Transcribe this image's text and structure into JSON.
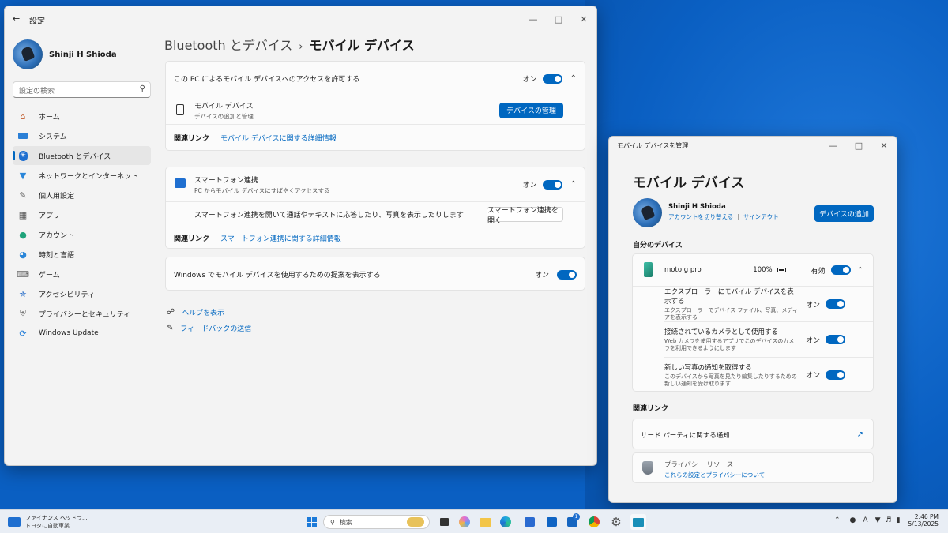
{
  "settings": {
    "title": "設定",
    "user_name": "Shinji H Shioda",
    "search_placeholder": "設定の検索",
    "nav": [
      {
        "label": "ホーム",
        "icon": "home-icon"
      },
      {
        "label": "システム",
        "icon": "monitor-icon"
      },
      {
        "label": "Bluetooth とデバイス",
        "icon": "bluetooth-icon",
        "selected": true
      },
      {
        "label": "ネットワークとインターネット",
        "icon": "wifi-icon"
      },
      {
        "label": "個人用設定",
        "icon": "brush-icon"
      },
      {
        "label": "アプリ",
        "icon": "apps-icon"
      },
      {
        "label": "アカウント",
        "icon": "person-icon"
      },
      {
        "label": "時刻と言語",
        "icon": "clock-globe-icon"
      },
      {
        "label": "ゲーム",
        "icon": "gamepad-icon"
      },
      {
        "label": "アクセシビリティ",
        "icon": "accessibility-icon"
      },
      {
        "label": "プライバシーとセキュリティ",
        "icon": "shield-icon"
      },
      {
        "label": "Windows Update",
        "icon": "update-icon"
      }
    ],
    "breadcrumb": {
      "parent": "Bluetooth とデバイス",
      "current": "モバイル デバイス"
    },
    "card1": {
      "header": "この PC によるモバイル デバイスへのアクセスを許可する",
      "toggle_label": "オン",
      "toggle_on": true,
      "device_title": "モバイル デバイス",
      "device_sub": "デバイスの追加と管理",
      "manage_button": "デバイスの管理",
      "related_label": "関連リンク",
      "related_link": "モバイル デバイスに関する詳細情報"
    },
    "card2": {
      "title": "スマートフォン連携",
      "subtitle": "PC からモバイル デバイスにすばやくアクセスする",
      "toggle_label": "オン",
      "toggle_on": true,
      "description": "スマートフォン連携を開いて通話やテキストに応答したり、写真を表示したりします",
      "open_button": "スマートフォン連携を開く",
      "related_label": "関連リンク",
      "related_link": "スマートフォン連携に関する詳細情報"
    },
    "card3": {
      "label": "Windows でモバイル デバイスを使用するための提案を表示する",
      "toggle_label": "オン",
      "toggle_on": true
    },
    "help": "ヘルプを表示",
    "feedback": "フィードバックの送信"
  },
  "mobile": {
    "window_title": "モバイル デバイスを管理",
    "heading": "モバイル デバイス",
    "account": {
      "name": "Shinji H Shioda",
      "switch": "アカウントを切り替える",
      "signout": "サインアウト"
    },
    "add_button": "デバイスの追加",
    "my_devices": "自分のデバイス",
    "device": {
      "name": "moto g pro",
      "battery": "100%",
      "status_label": "有効",
      "enabled": true
    },
    "settings": [
      {
        "title": "エクスプローラーにモバイル デバイスを表示する",
        "desc": "エクスプローラーでデバイス ファイル、写真、メディアを表示する",
        "toggle_label": "オン",
        "on": true
      },
      {
        "title": "接続されているカメラとして使用する",
        "desc": "Web カメラを使用するアプリでこのデバイスのカメラを利用できるようにします",
        "toggle_label": "オン",
        "on": true
      },
      {
        "title": "新しい写真の通知を取得する",
        "desc": "このデバイスから写真を見たり編集したりするための新しい通知を受け取ります",
        "toggle_label": "オン",
        "on": true
      }
    ],
    "related_heading": "関連リンク",
    "third_party": "サード パーティに関する通知",
    "privacy": {
      "title": "プライバシー リソース",
      "link": "これらの設定とプライバシーについて"
    }
  },
  "taskbar": {
    "news_title": "ファイナンス ヘッドラ...",
    "news_sub": "トヨタに自動車業...",
    "search_placeholder": "検索",
    "mail_badge": "1",
    "ime": "A",
    "time": "2:46 PM",
    "date": "5/13/2025"
  },
  "colors": {
    "accent": "#0067c0",
    "desktop": "#0a5fc2",
    "window_bg": "#f3f3f3"
  }
}
